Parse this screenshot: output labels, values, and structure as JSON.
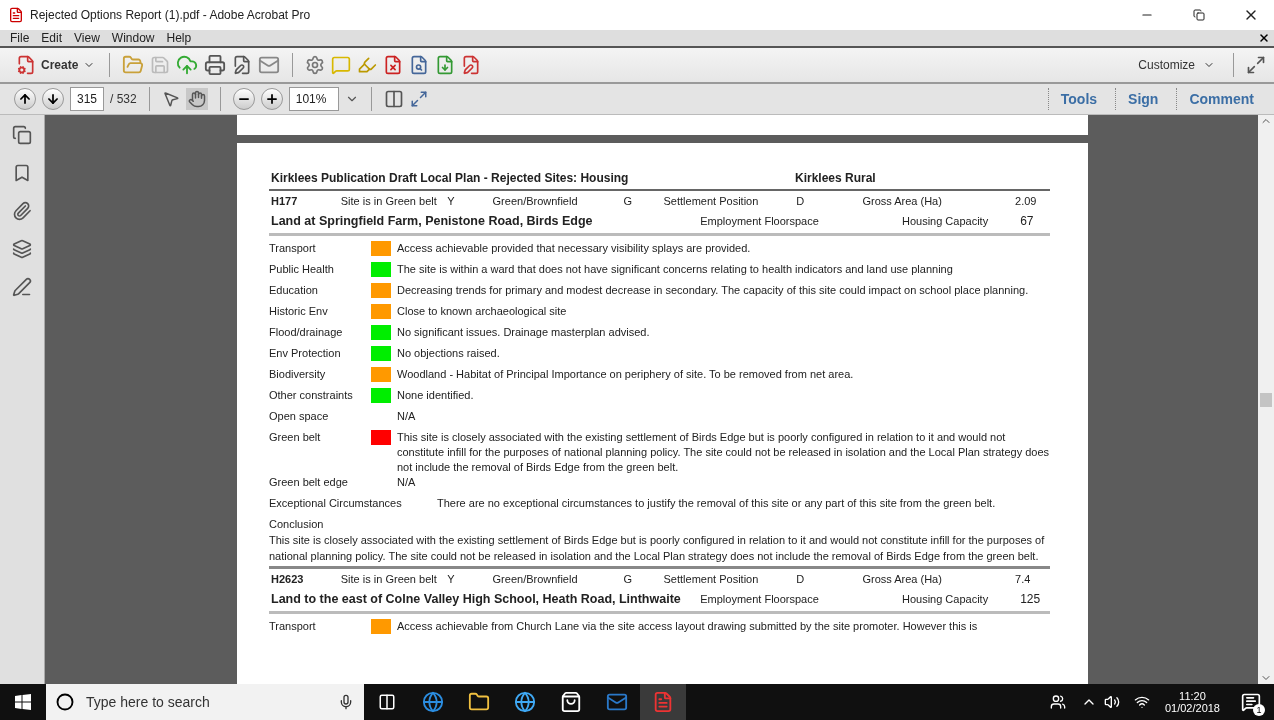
{
  "window": {
    "title": "Rejected Options Report (1).pdf - Adobe Acrobat Pro"
  },
  "menu": [
    "File",
    "Edit",
    "View",
    "Window",
    "Help"
  ],
  "toolbar": {
    "create": "Create",
    "customize": "Customize"
  },
  "navigation": {
    "page": "315",
    "total": "/ 532",
    "zoom": "101%"
  },
  "panes": [
    "Tools",
    "Sign",
    "Comment"
  ],
  "document": {
    "header": {
      "title": "Kirklees Publication Draft Local Plan - Rejected Sites:  Housing",
      "area": "Kirklees Rural"
    },
    "sites": [
      {
        "code": "H177",
        "fields": [
          {
            "label": "Site is in Green belt",
            "value": "Y"
          },
          {
            "label": "Green/Brownfield",
            "value": "G"
          },
          {
            "label": "Settlement Position",
            "value": "D"
          },
          {
            "label": "Gross Area (Ha)",
            "value": "2.09"
          }
        ],
        "name": "Land at Springfield Farm, Penistone Road, Birds Edge",
        "employment_label": "Employment Floorspace",
        "capacity_label": "Housing Capacity",
        "capacity": "67",
        "criteria": [
          {
            "kind": "rated",
            "label": "Transport",
            "color": "#ff9900",
            "text": "Access achievable provided that necessary visibility splays are provided."
          },
          {
            "kind": "rated",
            "label": "Public Health",
            "color": "#00ee00",
            "text": "The site is within a ward that does not have significant concerns relating to health indicators and land use planning"
          },
          {
            "kind": "rated",
            "label": "Education",
            "color": "#ff9900",
            "text": "Decreasing trends for primary and modest decrease in secondary. The capacity of this site could impact on school place planning."
          },
          {
            "kind": "rated",
            "label": "Historic Env",
            "color": "#ff9900",
            "text": "Close to known archaeological site"
          },
          {
            "kind": "rated",
            "label": "Flood/drainage",
            "color": "#00ee00",
            "text": "No significant issues.  Drainage masterplan advised."
          },
          {
            "kind": "rated",
            "label": "Env Protection",
            "color": "#00ee00",
            "text": "No objections raised."
          },
          {
            "kind": "rated",
            "label": "Biodiversity",
            "color": "#ff9900",
            "text": "Woodland - Habitat of Principal Importance on periphery of site. To be removed from net area."
          },
          {
            "kind": "rated",
            "label": "Other constraints",
            "color": "#00ee00",
            "text": "None identified."
          },
          {
            "kind": "plain",
            "label": "Open space",
            "text": "N/A"
          },
          {
            "kind": "rated",
            "label": "Green belt",
            "color": "#ff0000",
            "text": "This site is closely associated with the existing settlement of Birds Edge but is poorly configured in relation to it and would not constitute infill for the purposes of national planning policy. The site could not be released in isolation and the Local Plan strategy does not include the removal of Birds Edge from the green belt."
          },
          {
            "kind": "plain",
            "label": "Green belt edge",
            "text": "N/A"
          },
          {
            "kind": "wide",
            "label": "Exceptional Circumstances",
            "text": "There are no exceptional circumstances to justify the removal of this site or any part of this site from the green belt."
          }
        ],
        "conclusion": {
          "label": "Conclusion",
          "text": "This site is closely associated with the existing settlement of Birds Edge but is poorly configured in relation to it and would not constitute infill for the purposes of national planning policy. The site could not be released in isolation and the Local Plan strategy does not include the removal of Birds Edge from the green belt."
        }
      },
      {
        "code": "H2623",
        "fields": [
          {
            "label": "Site is in Green belt",
            "value": "Y"
          },
          {
            "label": "Green/Brownfield",
            "value": "G"
          },
          {
            "label": "Settlement Position",
            "value": "D"
          },
          {
            "label": "Gross Area (Ha)",
            "value": "7.4"
          }
        ],
        "name": "Land to the east of Colne Valley High School, Heath Road, Linthwaite",
        "employment_label": "Employment Floorspace",
        "capacity_label": "Housing Capacity",
        "capacity": "125",
        "criteria": [
          {
            "kind": "rated",
            "label": "Transport",
            "color": "#ff9900",
            "text": "Access achievable from Church Lane via the site access layout drawing submitted by the site promoter.  However this is"
          }
        ]
      }
    ]
  },
  "taskbar": {
    "search_placeholder": "Type here to search",
    "time": "11:20",
    "date": "01/02/2018",
    "notifications": "1"
  }
}
